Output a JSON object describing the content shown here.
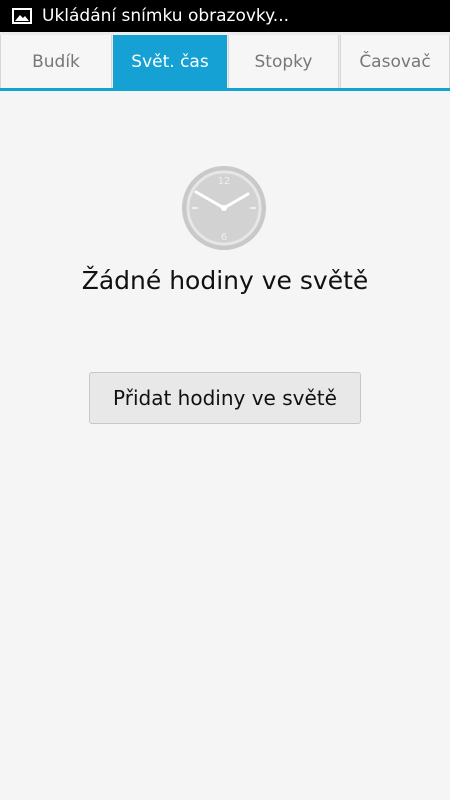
{
  "status_bar": {
    "notification_icon": "image-icon",
    "text": "Ukládání snímku obrazovky..."
  },
  "tabs": [
    {
      "label": "Budík",
      "active": false
    },
    {
      "label": "Svět. čas",
      "active": true
    },
    {
      "label": "Stopky",
      "active": false
    },
    {
      "label": "Časovač",
      "active": false
    }
  ],
  "main": {
    "icon": "clock-icon",
    "clock_numbers": {
      "top": "12",
      "bottom": "6"
    },
    "empty_title": "Žádné hodiny ve světě",
    "add_button_label": "Přidat hodiny ve světě"
  },
  "colors": {
    "accent": "#16a1d4",
    "status_bar": "#000000",
    "background": "#f5f5f5"
  }
}
